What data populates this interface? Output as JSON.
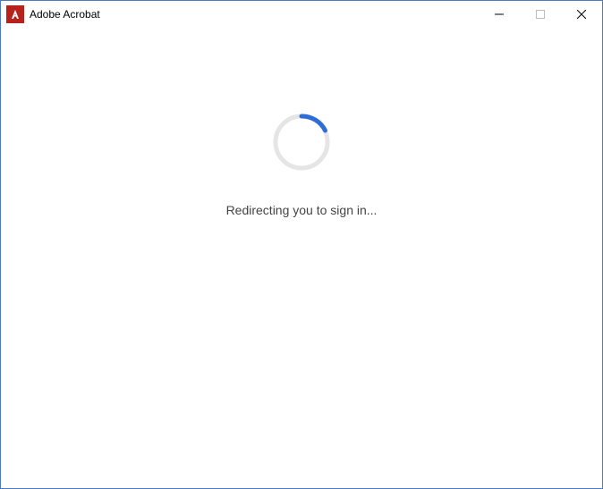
{
  "titlebar": {
    "title": "Adobe Acrobat"
  },
  "content": {
    "status_text": "Redirecting you to sign in..."
  }
}
